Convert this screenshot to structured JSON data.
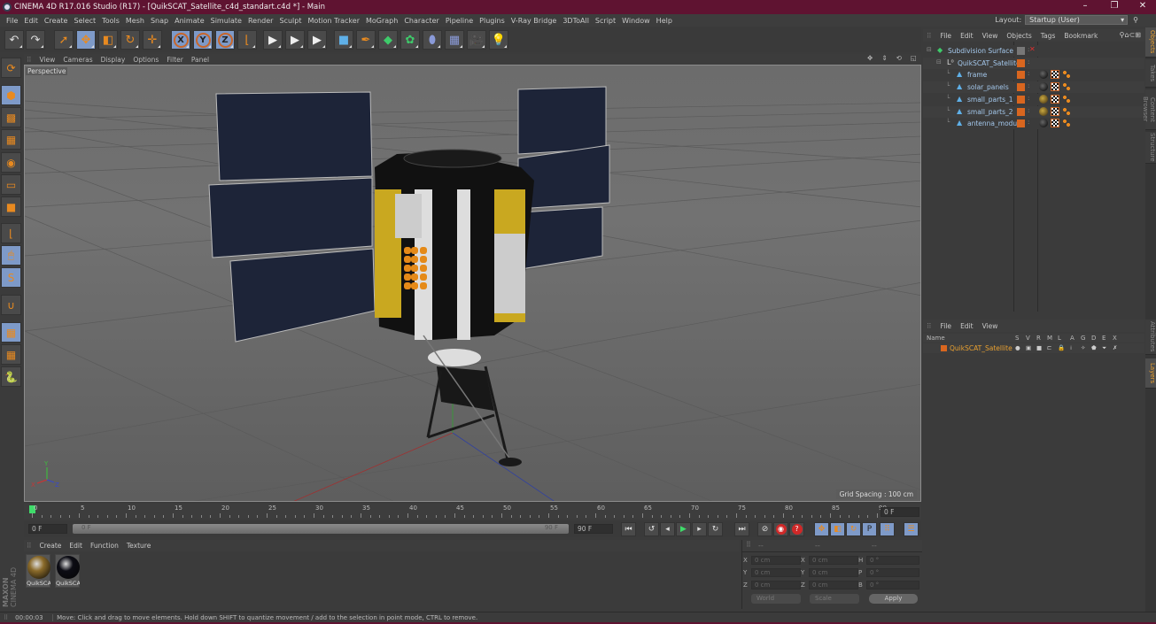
{
  "window": {
    "title": "CINEMA 4D R17.016 Studio (R17) - [QuikSCAT_Satellite_c4d_standart.c4d *] - Main",
    "controls": {
      "minimize": "–",
      "restore": "❐",
      "close": "✕"
    }
  },
  "menubar": {
    "items": [
      "File",
      "Edit",
      "Create",
      "Select",
      "Tools",
      "Mesh",
      "Snap",
      "Animate",
      "Simulate",
      "Render",
      "Sculpt",
      "Motion Tracker",
      "MoGraph",
      "Character",
      "Pipeline",
      "Plugins",
      "V-Ray Bridge",
      "3DToAll",
      "Script",
      "Window",
      "Help"
    ],
    "layout_label": "Layout:",
    "layout_value": "Startup (User)"
  },
  "toolbar": {
    "buttons": [
      {
        "name": "undo",
        "icon": "undo-icon",
        "glyph": "↶"
      },
      {
        "name": "redo",
        "icon": "redo-icon",
        "glyph": "↷"
      },
      {
        "name": "live-selection",
        "icon": "cursor-icon",
        "glyph": "➚"
      },
      {
        "name": "move",
        "icon": "move-icon",
        "glyph": "✥"
      },
      {
        "name": "scale",
        "icon": "scale-icon",
        "glyph": "◧"
      },
      {
        "name": "rotate",
        "icon": "rotate-icon",
        "glyph": "↻"
      },
      {
        "name": "recent-tool",
        "icon": "move-icon",
        "glyph": "✛"
      },
      {
        "name": "x-axis",
        "icon": "x-axis-icon",
        "glyph": "X"
      },
      {
        "name": "y-axis",
        "icon": "y-axis-icon",
        "glyph": "Y"
      },
      {
        "name": "z-axis",
        "icon": "z-axis-icon",
        "glyph": "Z"
      },
      {
        "name": "coordinate-system",
        "icon": "world-axis-icon",
        "glyph": "⌊"
      },
      {
        "name": "render-view",
        "icon": "clapper-icon",
        "glyph": "▶"
      },
      {
        "name": "render-picture-viewer",
        "icon": "clapper-icon",
        "glyph": "▶"
      },
      {
        "name": "render-settings",
        "icon": "clapper-gear-icon",
        "glyph": "▶"
      },
      {
        "name": "cube",
        "icon": "cube-icon",
        "glyph": "■"
      },
      {
        "name": "pen",
        "icon": "pen-icon",
        "glyph": "✒"
      },
      {
        "name": "subdivision-surface",
        "icon": "subdivision-icon",
        "glyph": "◆"
      },
      {
        "name": "cloner",
        "icon": "cloner-icon",
        "glyph": "✿"
      },
      {
        "name": "deformer",
        "icon": "deformer-icon",
        "glyph": "⬮"
      },
      {
        "name": "floor",
        "icon": "floor-icon",
        "glyph": "▦"
      },
      {
        "name": "camera",
        "icon": "camera-icon",
        "glyph": "🎥"
      },
      {
        "name": "light",
        "icon": "light-bulb-icon",
        "glyph": "💡"
      }
    ]
  },
  "left_tools": [
    {
      "name": "make-editable",
      "icon": "make-editable-icon"
    },
    {
      "name": "model-mode",
      "icon": "model-mode-icon"
    },
    {
      "name": "texture-mode",
      "icon": "texture-mode-icon"
    },
    {
      "name": "workplane-mode",
      "icon": "workplane-icon"
    },
    {
      "name": "points-mode",
      "icon": "points-mode-icon"
    },
    {
      "name": "edges-mode",
      "icon": "edges-mode-icon"
    },
    {
      "name": "polygons-mode",
      "icon": "polygons-mode-icon"
    },
    {
      "name": "axis-mode",
      "icon": "axis-mode-icon"
    },
    {
      "name": "tweak-mode",
      "icon": "mouse-icon"
    },
    {
      "name": "solo-mode",
      "icon": "solo-icon"
    },
    {
      "name": "snap",
      "icon": "magnet-icon"
    },
    {
      "name": "workplane-lock",
      "icon": "grid-lock-icon"
    },
    {
      "name": "workplane-rotate",
      "icon": "grid-rotate-icon"
    },
    {
      "name": "python",
      "icon": "python-icon"
    }
  ],
  "viewport": {
    "menu": [
      "View",
      "Cameras",
      "Display",
      "Options",
      "Filter",
      "Panel"
    ],
    "camera_label": "Perspective",
    "grid_spacing": "Grid Spacing : 100 cm",
    "nav_icons": [
      "move-view-icon",
      "dolly-icon",
      "rotate-view-icon",
      "maximize-icon"
    ],
    "axis_labels": {
      "x": "X",
      "y": "Y",
      "z": "Z"
    }
  },
  "timeline": {
    "ticks": [
      "0",
      "5",
      "10",
      "15",
      "20",
      "25",
      "30",
      "35",
      "40",
      "45",
      "50",
      "55",
      "60",
      "65",
      "70",
      "75",
      "80",
      "85",
      "90"
    ],
    "current_frame_field": "0 F",
    "start_field": "0 F",
    "range_start_label": "0 F",
    "range_end_label": "90 F",
    "end_field": "90 F",
    "current_frame": 0,
    "max_frame": 90
  },
  "playback": {
    "buttons": [
      {
        "name": "go-to-start",
        "glyph": "⏮"
      },
      {
        "name": "previous-key",
        "glyph": "↺"
      },
      {
        "name": "previous-frame",
        "glyph": "◂"
      },
      {
        "name": "play",
        "glyph": "▶"
      },
      {
        "name": "next-frame",
        "glyph": "▸"
      },
      {
        "name": "next-key",
        "glyph": "↻"
      },
      {
        "name": "go-to-end",
        "glyph": "⏭"
      },
      {
        "name": "record-off",
        "glyph": "⊘"
      },
      {
        "name": "record-keys",
        "glyph": "◉"
      },
      {
        "name": "auto-keying",
        "glyph": "?"
      },
      {
        "name": "key-position",
        "glyph": "✥"
      },
      {
        "name": "key-scale",
        "glyph": "◧"
      },
      {
        "name": "key-rotation",
        "glyph": "↻"
      },
      {
        "name": "key-parameter",
        "glyph": "P"
      },
      {
        "name": "key-pla",
        "glyph": "⠿"
      },
      {
        "name": "timeline-window",
        "glyph": "☰"
      }
    ]
  },
  "material_manager": {
    "menu": [
      "Create",
      "Edit",
      "Function",
      "Texture"
    ],
    "materials": [
      {
        "label": "QuikSCA",
        "color": "#8a6a2a"
      },
      {
        "label": "QuikSCA",
        "color": "#0c0c14"
      }
    ],
    "brand_top": "MAXON",
    "brand_bottom": "CINEMA 4D"
  },
  "coordinates": {
    "header": [
      "--",
      "--",
      "--"
    ],
    "rows": [
      {
        "a": "X",
        "av": "0 cm",
        "b": "X",
        "bv": "0 cm",
        "c": "H",
        "cv": "0 °"
      },
      {
        "a": "Y",
        "av": "0 cm",
        "b": "Y",
        "bv": "0 cm",
        "c": "P",
        "cv": "0 °"
      },
      {
        "a": "Z",
        "av": "0 cm",
        "b": "Z",
        "bv": "0 cm",
        "c": "B",
        "cv": "0 °"
      }
    ],
    "mode_select": "World",
    "size_select": "Scale",
    "apply_label": "Apply"
  },
  "object_manager": {
    "menu": [
      "File",
      "Edit",
      "View",
      "Objects",
      "Tags",
      "Bookmark"
    ],
    "objects": [
      {
        "name": "Subdivision Surface",
        "indent": 0,
        "icon": "subdivision-icon",
        "tags": []
      },
      {
        "name": "QuikSCAT_Satellite",
        "indent": 1,
        "icon": "null-object-icon",
        "tags": []
      },
      {
        "name": "frame",
        "indent": 2,
        "icon": "polygon-object-icon",
        "tags": [
          "black",
          "check",
          "dots"
        ]
      },
      {
        "name": "solar_panels",
        "indent": 2,
        "icon": "polygon-object-icon",
        "tags": [
          "black",
          "check",
          "dots"
        ]
      },
      {
        "name": "small_parts_1",
        "indent": 2,
        "icon": "polygon-object-icon",
        "tags": [
          "gold",
          "check",
          "dots"
        ]
      },
      {
        "name": "small_parts_2",
        "indent": 2,
        "icon": "polygon-object-icon",
        "tags": [
          "gold",
          "check",
          "dots"
        ]
      },
      {
        "name": "antenna_module",
        "indent": 2,
        "icon": "polygon-object-icon",
        "tags": [
          "black",
          "check",
          "dots"
        ]
      }
    ]
  },
  "layer_manager": {
    "menu": [
      "File",
      "Edit",
      "View"
    ],
    "columns": [
      "Name",
      "S",
      "V",
      "R",
      "M",
      "L",
      "A",
      "G",
      "D",
      "E",
      "X"
    ],
    "layers": [
      {
        "name": "QuikSCAT_Satellite",
        "color": "#d9661f"
      }
    ]
  },
  "side_tabs": {
    "top": [
      {
        "label": "Objects",
        "active": true
      },
      {
        "label": "Takes",
        "active": false
      },
      {
        "label": "Content Browser",
        "active": false
      },
      {
        "label": "Structure",
        "active": false
      }
    ],
    "bottom": [
      {
        "label": "Attributes",
        "active": false
      },
      {
        "label": "Layers",
        "active": true
      }
    ]
  },
  "status": {
    "time": "00:00:03",
    "message": "Move: Click and drag to move elements. Hold down SHIFT to quantize movement / add to the selection in point mode, CTRL to remove."
  },
  "colors": {
    "title_bar": "#5f1331",
    "accent_orange": "#e88a20",
    "active_blue": "#7e9ac8",
    "object_name": "#a4c8ec",
    "layer_name": "#e8a030"
  }
}
